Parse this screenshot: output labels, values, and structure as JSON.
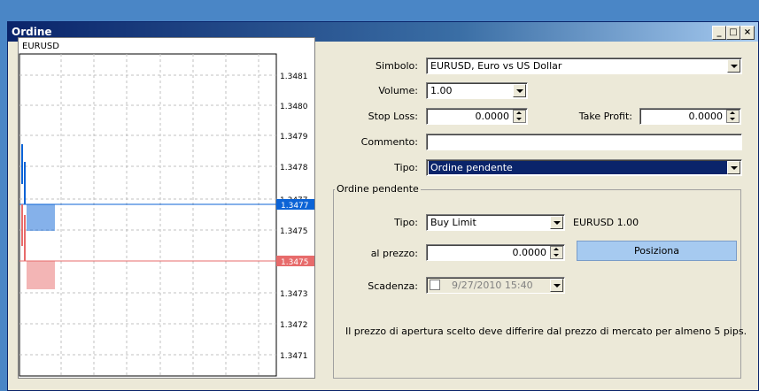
{
  "window": {
    "title": "Ordine"
  },
  "chart": {
    "symbol": "EURUSD",
    "price_labels": [
      "1.3481",
      "1.3480",
      "1.3479",
      "1.3478",
      "1.3477",
      "1.3475",
      "1.3474",
      "1.3473",
      "1.3472",
      "1.3471"
    ],
    "ask_label": "1.3477",
    "bid_label": "1.3475",
    "colors": {
      "ask": "#0b63d6",
      "bid": "#e76b6b"
    }
  },
  "form": {
    "simbolo": {
      "label": "Simbolo:",
      "value": "EURUSD, Euro vs US Dollar"
    },
    "volume": {
      "label": "Volume:",
      "value": "1.00"
    },
    "stop_loss": {
      "label": "Stop Loss:",
      "value": "0.0000"
    },
    "take_profit": {
      "label": "Take Profit:",
      "value": "0.0000"
    },
    "commento": {
      "label": "Commento:",
      "value": ""
    },
    "tipo": {
      "label": "Tipo:",
      "value": "Ordine pendente"
    }
  },
  "pending": {
    "title": "Ordine pendente",
    "tipo": {
      "label": "Tipo:",
      "value": "Buy Limit"
    },
    "info": "EURUSD 1.00",
    "prezzo": {
      "label": "al prezzo:",
      "value": "0.0000"
    },
    "posiziona": "Posiziona",
    "scadenza": {
      "label": "Scadenza:",
      "value": "9/27/2010 15:40"
    },
    "note": "Il prezzo di apertura scelto deve differire dal prezzo di mercato per almeno 5 pips."
  }
}
